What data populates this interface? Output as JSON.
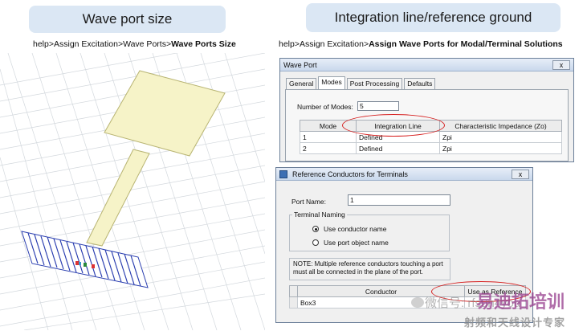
{
  "left_panel": {
    "title": "Wave port size",
    "path_prefix": "help>Assign Excitation>Wave Ports>",
    "path_bold": "Wave Ports Size"
  },
  "right_panel": {
    "title": "Integration line/reference ground",
    "path_prefix": "help>Assign Excitation>",
    "path_bold": "Assign Wave Ports for Modal/Terminal Solutions"
  },
  "wave_port_dialog": {
    "title": "Wave Port",
    "close": "x",
    "tabs": [
      "General",
      "Modes",
      "Post Processing",
      "Defaults"
    ],
    "modes_label": "Number of Modes:",
    "modes_value": "5",
    "columns": [
      "Mode",
      "Integration Line",
      "Characteristic Impedance (Zo)"
    ],
    "rows": [
      {
        "mode": "1",
        "line": "Defined",
        "imp": "Zpi"
      },
      {
        "mode": "2",
        "line": "Defined",
        "imp": "Zpi"
      }
    ]
  },
  "ref_dialog": {
    "title": "Reference Conductors for Terminals",
    "close": "x",
    "port_name_label": "Port Name:",
    "port_name_value": "1",
    "naming_legend": "Terminal Naming",
    "opt1": "Use conductor name",
    "opt2": "Use port object name",
    "note": "NOTE: Multiple reference conductors touching a port must all be connected in the plane of the port.",
    "columns": [
      "Conductor",
      "Use as Reference"
    ],
    "rows": [
      {
        "conductor": "Box3",
        "ref": ""
      }
    ]
  },
  "watermark": {
    "wechat": "微信号",
    "brand": "易迪拓培训",
    "id": "rfsun4you",
    "sub": "射频和天线设计专家"
  },
  "colors": {
    "title_bg": "#dbe7f4",
    "highlight": "#d62020",
    "patch": "#f6f3c8",
    "port_stripes": "#2b3fb0"
  }
}
